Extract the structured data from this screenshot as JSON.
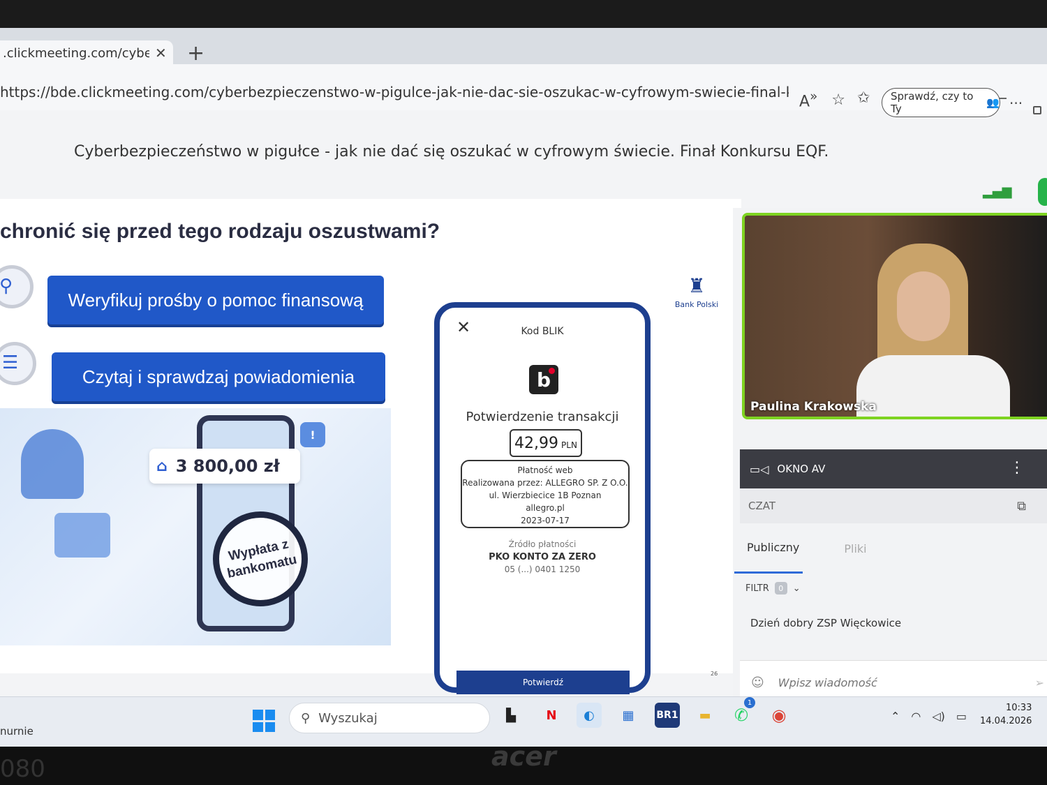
{
  "browser": {
    "tab_title": ".clickmeeting.com/cyberb",
    "tab_close": "✕",
    "new_tab": "+",
    "url": "https://bde.clickmeeting.com/cyberbezpieczenstwo-w-pigulce-jak-nie-dac-sie-oszukac-w-cyfrowym-swiecie-final-konkursu-eqf-?r...",
    "check_pill": "Sprawdź, czy to Ty",
    "more": "···"
  },
  "meeting": {
    "title": "Cyberbezpieczeństwo w pigułce - jak nie dać się oszukać w cyfrowym świecie. Finał Konkursu EQF."
  },
  "slide": {
    "heading": "chronić się przed tego rodzaju oszustwami?",
    "btn_verify": "Weryfikuj prośby o pomoc finansową",
    "btn_read": "Czytaj i sprawdzaj powiadomienia",
    "amount": "3 800,00 zł",
    "magnifier_text": "Wypłata z bankomatu",
    "alert": "!",
    "pko_label": "Bank Polski",
    "page_number": "26"
  },
  "blik": {
    "header": "Kod BLIK",
    "confirm_title": "Potwierdzenie transakcji",
    "amount": "42,99",
    "currency": "PLN",
    "details": [
      "Płatność web",
      "Realizowana przez: ALLEGRO SP. Z O.O.",
      "ul. Wierzbiecice 1B Poznan",
      "allegro.pl",
      "2023-07-17"
    ],
    "source_label": "Źródło płatności",
    "source": "PKO KONTO ZA ZERO",
    "account": "05 (...) 0401 1250",
    "button": "Potwierdź"
  },
  "video": {
    "speaker": "Paulina Krakowska",
    "panel_label": "OKNO AV"
  },
  "chat": {
    "header": "CZAT",
    "tab_public": "Publiczny",
    "tab_files": "Pliki",
    "filter_label": "FILTR",
    "filter_count": "0",
    "message": "Dzień dobry ZSP Więckowice",
    "input_placeholder": "Wpisz wiadomość"
  },
  "taskbar": {
    "search_placeholder": "Wyszukaj",
    "side_label": "nurnie",
    "time": "10:33",
    "date": "14.04.2026",
    "whatsapp_badge": "1",
    "netflix": "N",
    "br1": "BR1"
  },
  "hardware": {
    "brand": "acer",
    "model": "080"
  },
  "colors": {
    "accent_blue": "#2058c8",
    "pko_blue": "#1d3f8f",
    "video_border": "#7ed321"
  }
}
